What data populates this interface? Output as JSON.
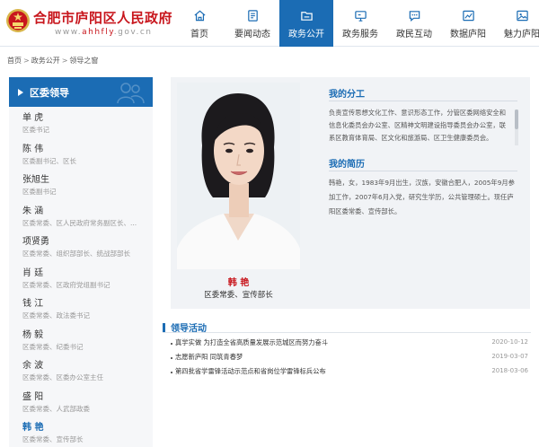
{
  "header": {
    "title": "合肥市庐阳区人民政府",
    "url_prefix": "www.",
    "url_highlight": "ahhfly",
    "url_suffix": ".gov.cn"
  },
  "nav": [
    {
      "label": "首页",
      "icon": "home-icon",
      "active": false
    },
    {
      "label": "要闻动态",
      "icon": "news-icon",
      "active": false
    },
    {
      "label": "政务公开",
      "icon": "folder-icon",
      "active": true
    },
    {
      "label": "政务服务",
      "icon": "monitor-icon",
      "active": false
    },
    {
      "label": "政民互动",
      "icon": "chat-icon",
      "active": false
    },
    {
      "label": "数据庐阳",
      "icon": "chart-icon",
      "active": false
    },
    {
      "label": "魅力庐阳",
      "icon": "image-icon",
      "active": false
    }
  ],
  "breadcrumb": [
    "首页",
    "政务公开",
    "领导之窗"
  ],
  "sidebar": {
    "title": "区委领导",
    "leaders": [
      {
        "name": "单  虎",
        "position": "区委书记"
      },
      {
        "name": "陈  伟",
        "position": "区委副书记、区长"
      },
      {
        "name": "张旭生",
        "position": "区委副书记"
      },
      {
        "name": "朱  涵",
        "position": "区委常委、区人民政府常务副区长、..."
      },
      {
        "name": "项贤勇",
        "position": "区委常委、组织部部长、统战部部长"
      },
      {
        "name": "肖  廷",
        "position": "区委常委、区政府党组副书记"
      },
      {
        "name": "钱  江",
        "position": "区委常委、政法委书记"
      },
      {
        "name": "杨  毅",
        "position": "区委常委、纪委书记"
      },
      {
        "name": "余  波",
        "position": "区委常委、区委办公室主任"
      },
      {
        "name": "盛  阳",
        "position": "区委常委、人武部政委"
      },
      {
        "name": "韩  艳",
        "position": "区委常委、宣传部长"
      }
    ],
    "active_index": 10
  },
  "profile": {
    "name": "韩 艳",
    "position": "区委常委、宣传部长",
    "duty_title": "我的分工",
    "duty_text": "负责宣传思想文化工作、意识形态工作，分管区委网络安全和信息化委员会办公室、区精神文明建设指导委员会办公室，联系区教育体育局、区文化和旅游局、区卫生健康委员会。",
    "bio_title": "我的简历",
    "bio_text": "韩艳，女，1983年9月出生，汉族，安徽合肥人，2005年9月参加工作，2007年6月入党，研究生学历，公共管理硕士。现任庐阳区委常委、宣传部长。"
  },
  "activities": {
    "title": "领导活动",
    "items": [
      {
        "title": "真学实做 为打造全省高质量发展示范城区而努力奋斗",
        "date": "2020-10-12"
      },
      {
        "title": "志愿新庐阳 同筑青春梦",
        "date": "2019-03-07"
      },
      {
        "title": "第四批省学雷锋活动示范点和省岗位学雷锋标兵公布",
        "date": "2018-03-06"
      }
    ]
  },
  "colors": {
    "brand_red": "#c8161d",
    "brand_blue": "#1b6cb4"
  }
}
